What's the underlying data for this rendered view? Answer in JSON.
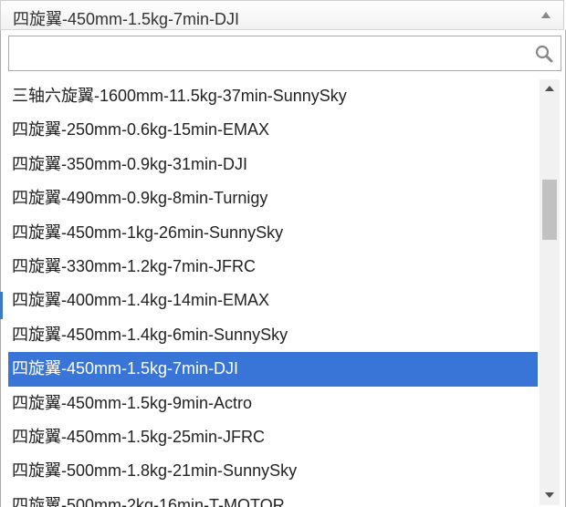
{
  "select": {
    "value": "四旋翼-450mm-1.5kg-7min-DJI",
    "arrow_icon": "triangle-up-icon"
  },
  "search": {
    "placeholder": "",
    "value": "",
    "icon": "search-icon"
  },
  "options": [
    "三轴六旋翼-1600mm-11.5kg-37min-SunnySky",
    "四旋翼-250mm-0.6kg-15min-EMAX",
    "四旋翼-350mm-0.9kg-31min-DJI",
    "四旋翼-490mm-0.9kg-8min-Turnigy",
    "四旋翼-450mm-1kg-26min-SunnySky",
    "四旋翼-330mm-1.2kg-7min-JFRC",
    "四旋翼-400mm-1.4kg-14min-EMAX",
    "四旋翼-450mm-1.4kg-6min-SunnySky",
    "四旋翼-450mm-1.5kg-7min-DJI",
    "四旋翼-450mm-1.5kg-9min-Actro",
    "四旋翼-450mm-1.5kg-25min-JFRC",
    "四旋翼-500mm-1.8kg-21min-SunnySky",
    "四旋翼-500mm-2kg-16min-T-MOTOR"
  ],
  "selected_index": 8,
  "colors": {
    "highlight": "#3875d7",
    "text": "#222222"
  }
}
